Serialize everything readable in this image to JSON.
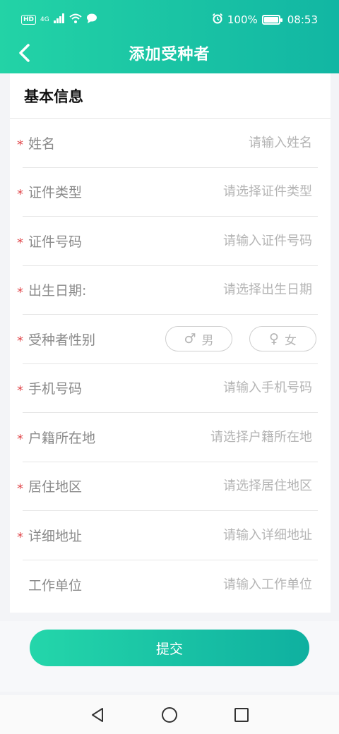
{
  "status_bar": {
    "hd": "HD",
    "signal": "4G",
    "battery_percent": "100%",
    "battery_level": 1.0,
    "time": "08:53"
  },
  "nav": {
    "title": "添加受种者",
    "back_icon": "chevron-left-icon"
  },
  "form": {
    "section_title": "基本信息",
    "required_mark": "*",
    "fields": [
      {
        "label": "姓名",
        "placeholder": "请输入姓名",
        "required": true
      },
      {
        "label": "证件类型",
        "placeholder": "请选择证件类型",
        "required": true
      },
      {
        "label": "证件号码",
        "placeholder": "请输入证件号码",
        "required": true
      },
      {
        "label": "出生日期:",
        "placeholder": "请选择出生日期",
        "required": true
      },
      {
        "label": "受种者性别",
        "required": true,
        "options": [
          "男",
          "女"
        ]
      },
      {
        "label": "手机号码",
        "placeholder": "请输入手机号码",
        "required": true
      },
      {
        "label": "户籍所在地",
        "placeholder": "请选择户籍所在地",
        "required": true
      },
      {
        "label": "居住地区",
        "placeholder": "请选择居住地区",
        "required": true
      },
      {
        "label": "详细地址",
        "placeholder": "请输入详细地址",
        "required": true
      },
      {
        "label": "工作单位",
        "placeholder": "请输入工作单位",
        "required": false
      }
    ]
  },
  "submit": {
    "label": "提交"
  },
  "colors": {
    "header_start": "#23d3a6",
    "header_end": "#12b6a3",
    "required": "#e0464a",
    "placeholder": "#b4b4b4"
  }
}
